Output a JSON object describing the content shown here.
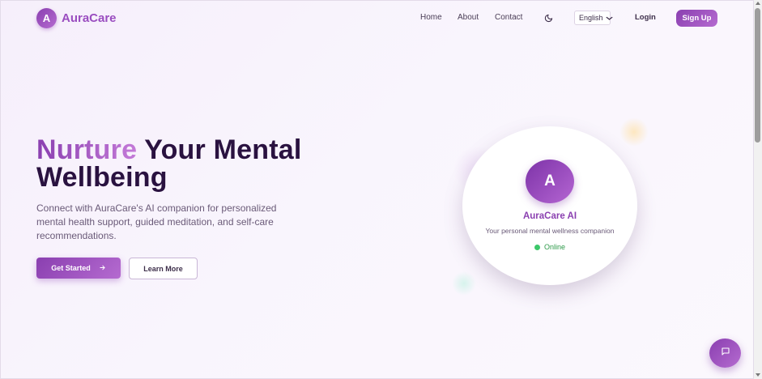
{
  "nav": {
    "brand": "AuraCare",
    "brand_mark": "A",
    "links": [
      "Home",
      "About",
      "Contact"
    ],
    "theme_icon": "moon-icon",
    "language": "English",
    "login": "Login",
    "signup": "Sign Up"
  },
  "hero": {
    "headline_accent": "Nurture",
    "headline_rest": "Your Mental",
    "headline_line2": "Wellbeing",
    "subtext": "Connect with AuraCare's AI companion for personalized mental health support, guided meditation, and self-care recommendations.",
    "primary_cta": "Get Started",
    "secondary_cta": "Learn More"
  },
  "ai_card": {
    "avatar_letter": "A",
    "name": "AuraCare AI",
    "tagline": "Your personal mental wellness companion",
    "status": "Online"
  },
  "colors": {
    "brand": "#8a3fb0",
    "brand_light": "#b56bd0",
    "headline": "#2a1240",
    "online": "#3cc86a"
  },
  "chat_fab_icon": "chat-icon"
}
